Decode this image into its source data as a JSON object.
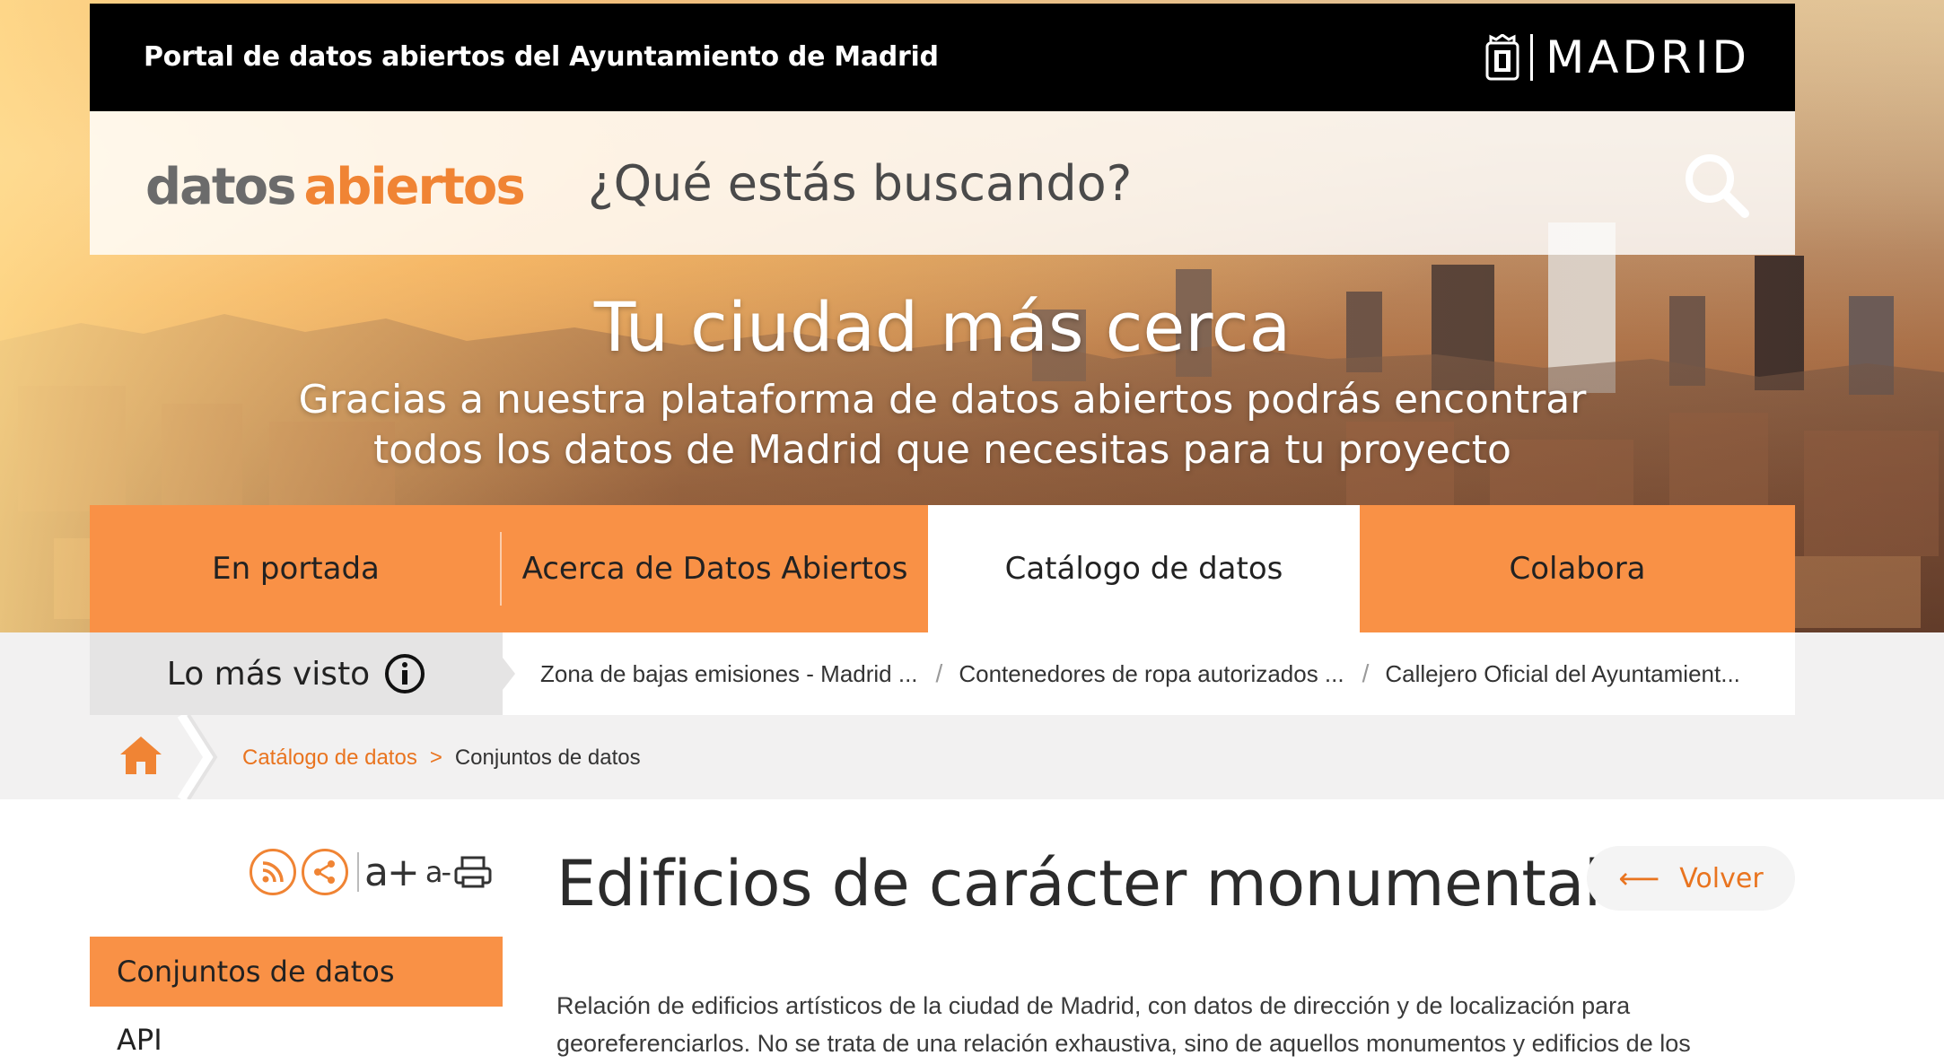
{
  "topbar": {
    "title": "Portal de datos abiertos del Ayuntamiento de Madrid",
    "logo_text": "MADRID"
  },
  "search": {
    "brand_part1": "datos",
    "brand_part2": "abiertos",
    "placeholder": "¿Qué estás buscando?"
  },
  "hero": {
    "title": "Tu ciudad más cerca",
    "subtitle_line1": "Gracias a nuestra plataforma de datos abiertos podrás encontrar",
    "subtitle_line2": "todos los datos de Madrid que necesitas para tu proyecto"
  },
  "nav": {
    "items": [
      {
        "label": "En portada"
      },
      {
        "label": "Acerca de Datos Abiertos"
      },
      {
        "label": "Catálogo de datos"
      },
      {
        "label": "Colabora"
      }
    ],
    "active_index": 2
  },
  "most_viewed": {
    "label": "Lo más visto",
    "links": [
      "Zona de bajas emisiones - Madrid ...",
      "Contenedores de ropa autorizados ...",
      "Callejero Oficial del Ayuntamient..."
    ]
  },
  "breadcrumb": {
    "link": "Catálogo de datos",
    "separator": ">",
    "current": "Conjuntos de datos"
  },
  "tools": {
    "icons": [
      "rss-icon",
      "share-icon",
      "font-increase-icon",
      "font-decrease-icon",
      "print-icon"
    ],
    "font_increase": "a+",
    "font_decrease": "a-"
  },
  "sidebar": {
    "items": [
      {
        "label": "Conjuntos de datos",
        "active": true
      },
      {
        "label": "API",
        "active": false
      }
    ]
  },
  "main": {
    "title": "Edificios de carácter monumental",
    "back_label": "Volver",
    "description": "Relación de edificios artísticos de la ciudad de Madrid, con datos de dirección y de localización para georeferenciarlos. No se trata de una relación exhaustiva, sino de aquellos monumentos y edificios de los"
  },
  "colors": {
    "accent_orange": "#f99146",
    "link_orange": "#e9741f",
    "topbar_black": "#000000",
    "strip_gray": "#f2f1f1"
  }
}
